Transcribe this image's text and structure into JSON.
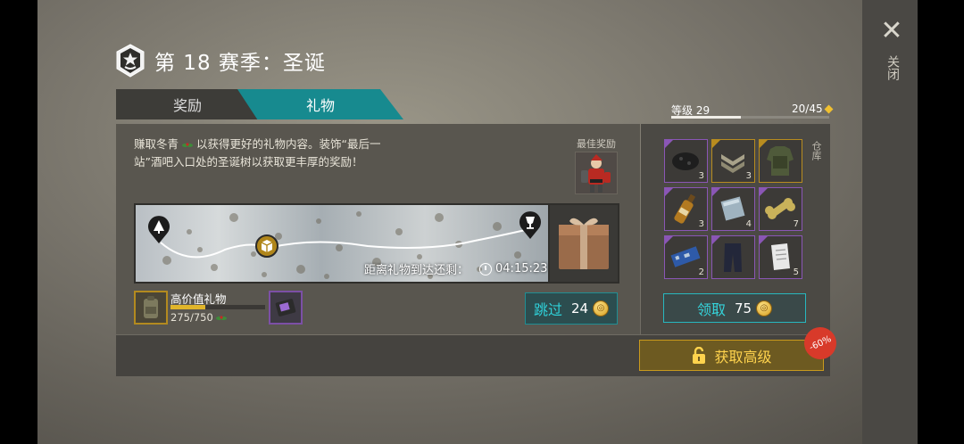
{
  "header": {
    "title": "第 18 赛季：圣诞",
    "badge_icon": "season-star-shield-icon"
  },
  "close": {
    "label": "关闭",
    "icon": "close-icon"
  },
  "tabs": [
    {
      "label": "奖励",
      "active": false
    },
    {
      "label": "礼物",
      "active": true
    }
  ],
  "gift_panel": {
    "description_part1": "赚取冬青",
    "description_part2": "以获得更好的礼物内容。装饰“最后一站”酒吧入口处的圣诞树以获取更丰厚的奖励！",
    "best_reward_label": "最佳奖励",
    "map": {
      "countdown_label": "距离礼物到达还剩：",
      "countdown_time": "04:15:23",
      "start_icon": "tree-pin-icon",
      "current_icon": "package-pin-icon",
      "end_icon": "bar-glass-pin-icon",
      "progress": 0.42
    },
    "high_value": {
      "title": "高价值礼物",
      "current": "275/750",
      "progress": 0.367
    },
    "skip_button": {
      "label": "跳过",
      "cost": "24"
    }
  },
  "level": {
    "label": "等级 29",
    "count": "20/45",
    "progress": 0.44
  },
  "storage": {
    "label": "仓库",
    "items": [
      {
        "icon": "coal-icon",
        "qty": "3",
        "rarity": "purple"
      },
      {
        "icon": "rank-badge-icon",
        "qty": "3",
        "rarity": "gold"
      },
      {
        "icon": "armor-jacket-icon",
        "qty": "",
        "rarity": "gold"
      },
      {
        "icon": "bottle-icon",
        "qty": "3",
        "rarity": "purple"
      },
      {
        "icon": "metal-plate-icon",
        "qty": "4",
        "rarity": "purple"
      },
      {
        "icon": "dog-bone-icon",
        "qty": "7",
        "rarity": "purple"
      },
      {
        "icon": "circuit-board-icon",
        "qty": "2",
        "rarity": "purple"
      },
      {
        "icon": "pants-icon",
        "qty": "",
        "rarity": "purple"
      },
      {
        "icon": "paper-note-icon",
        "qty": "5",
        "rarity": "purple"
      }
    ],
    "claim_button": {
      "label": "领取",
      "cost": "75"
    }
  },
  "premium": {
    "label": "获取高级",
    "discount": "-60%",
    "icon": "unlock-icon"
  },
  "colors": {
    "accent": "#178a8f",
    "gold": "#c99a1d",
    "cyan": "#2fd0d8"
  }
}
